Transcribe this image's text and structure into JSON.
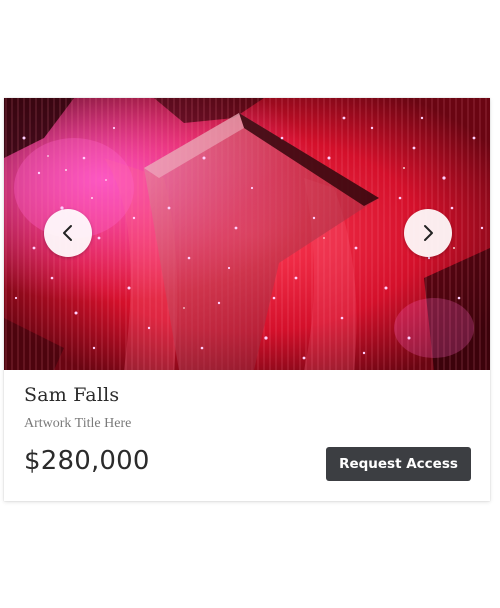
{
  "listing": {
    "artist": "Sam Falls",
    "artwork_title": "Artwork Title Here",
    "price": "$280,000",
    "request_label": "Request Access"
  },
  "carousel": {
    "prev_icon": "chevron-left-icon",
    "next_icon": "chevron-right-icon"
  },
  "colors": {
    "button_bg": "#3c3e42",
    "artwork_base": "#c8142e",
    "artwork_highlight": "#ff4fa0"
  }
}
